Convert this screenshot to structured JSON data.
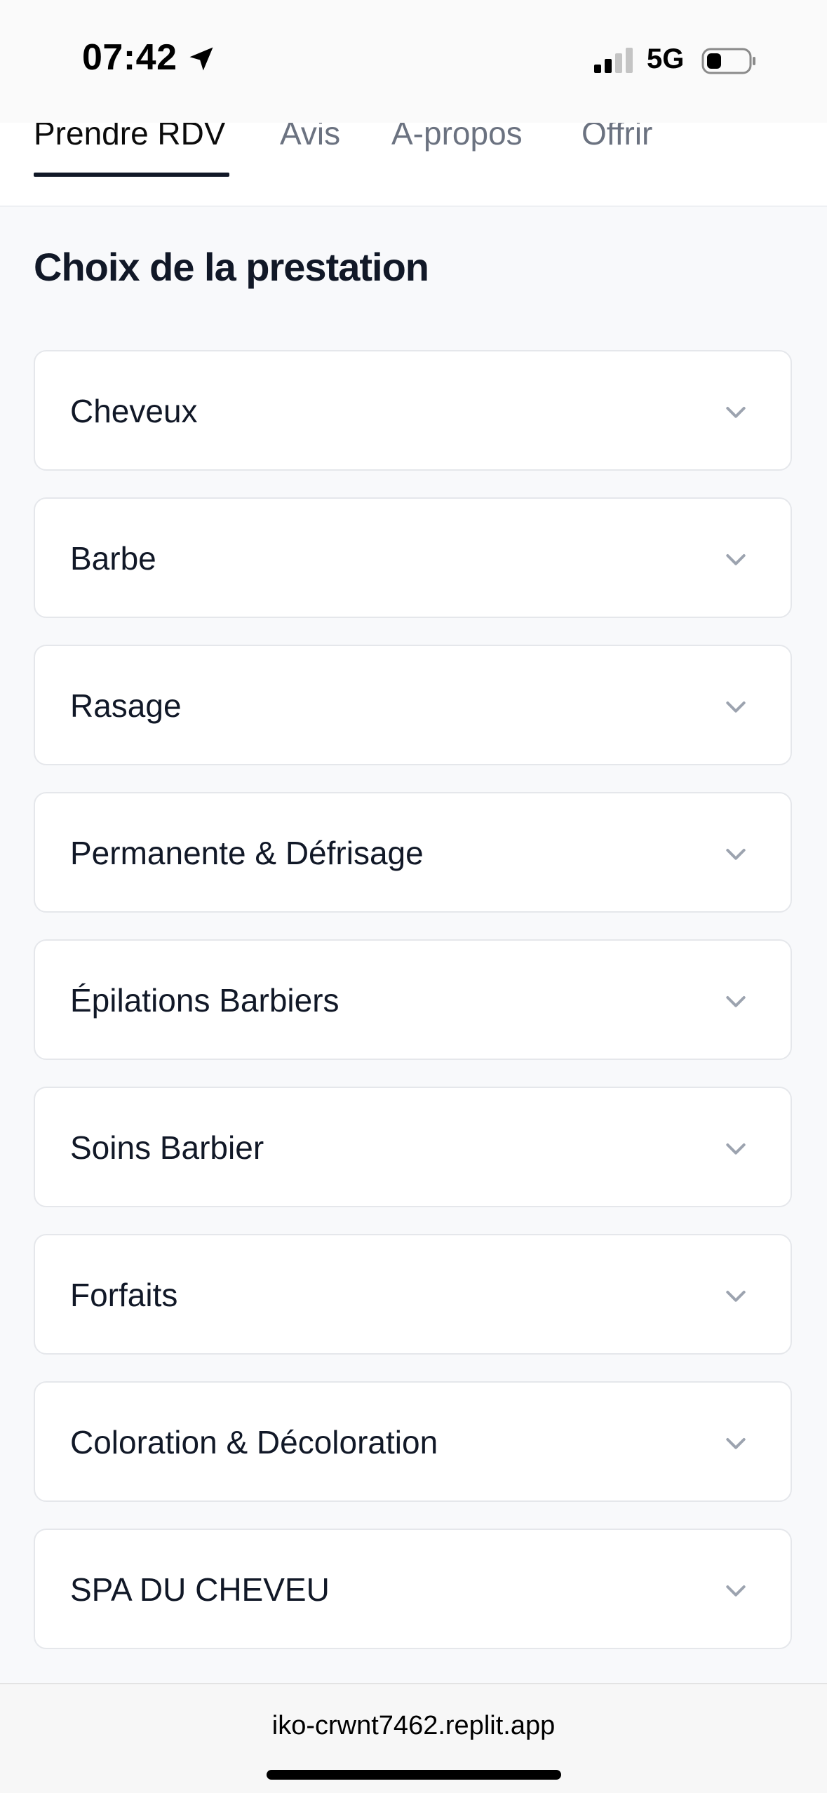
{
  "status_bar": {
    "time": "07:42",
    "network": "5G"
  },
  "tabs": [
    {
      "label": "Prendre RDV",
      "active": true
    },
    {
      "label": "Avis",
      "active": false
    },
    {
      "label": "A-propos",
      "active": false
    },
    {
      "label": "Offrir",
      "active": false
    }
  ],
  "main": {
    "title": "Choix de la prestation",
    "categories": [
      {
        "label": "Cheveux"
      },
      {
        "label": "Barbe"
      },
      {
        "label": "Rasage"
      },
      {
        "label": "Permanente & Défrisage"
      },
      {
        "label": "Épilations Barbiers"
      },
      {
        "label": "Soins Barbier"
      },
      {
        "label": "Forfaits"
      },
      {
        "label": "Coloration & Décoloration"
      },
      {
        "label": "SPA DU CHEVEU"
      }
    ]
  },
  "browser": {
    "url": "iko-crwnt7462.replit.app"
  },
  "icons": {
    "location": "location-arrow-icon",
    "signal": "cellular-signal-icon",
    "battery": "battery-icon",
    "chevron": "chevron-down-icon"
  },
  "colors": {
    "text_primary": "#111827",
    "text_muted": "#6b7280",
    "background": "#f8f9fb",
    "card_border": "#e5e7eb",
    "chevron": "#9ca3af"
  }
}
